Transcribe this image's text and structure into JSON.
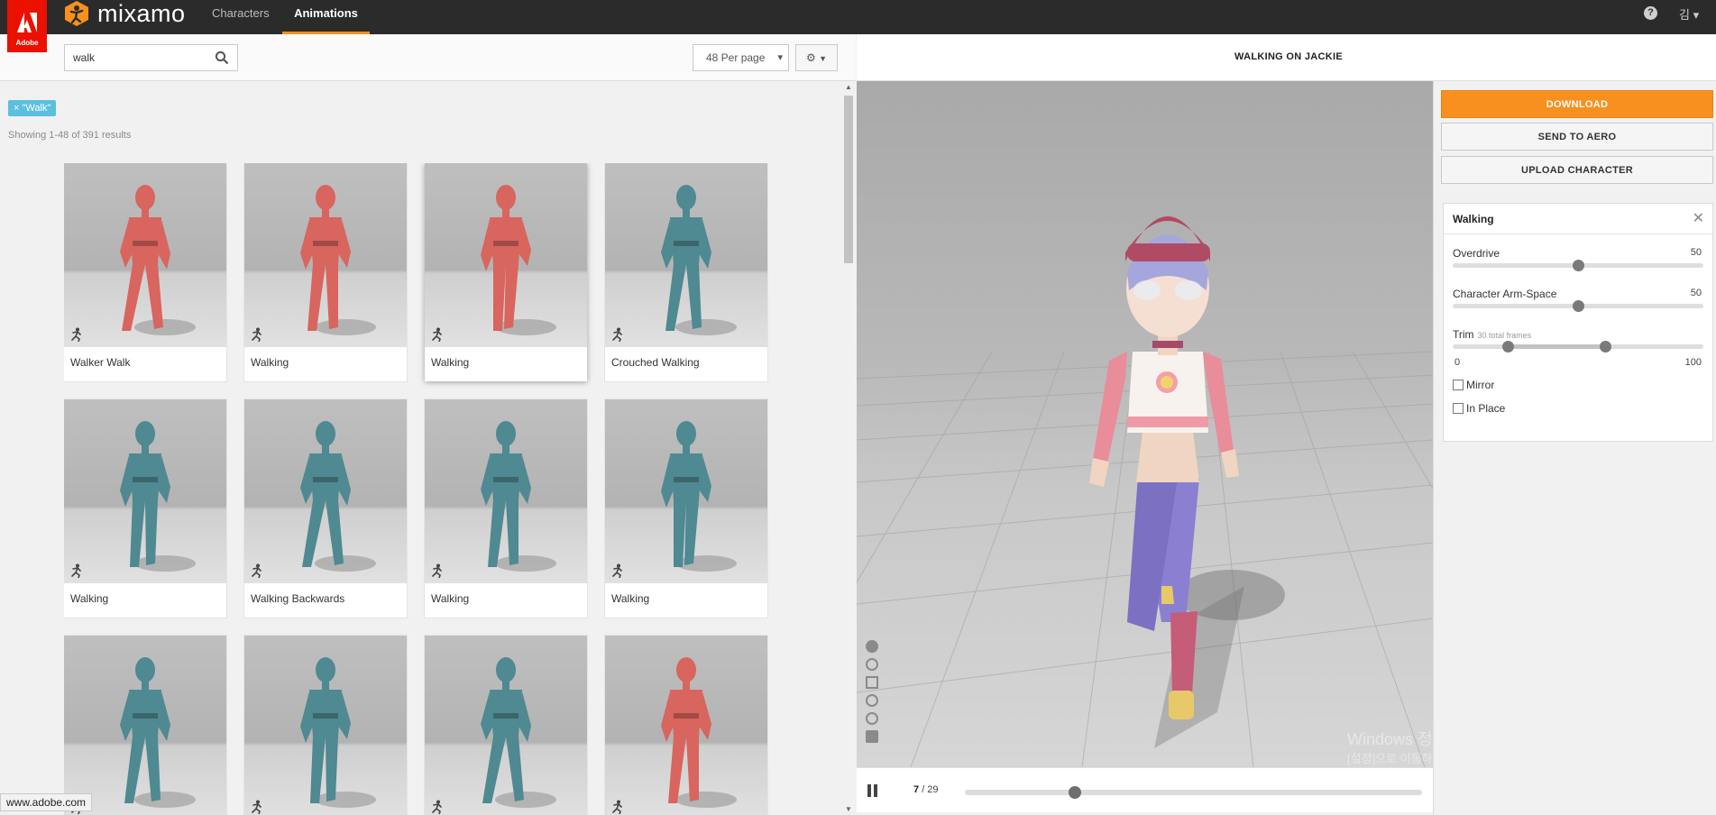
{
  "brand": {
    "adobe": "Adobe",
    "app": "mixamo"
  },
  "nav": {
    "tabs": [
      "Characters",
      "Animations"
    ],
    "active": "Animations",
    "help_icon": "question-circle-icon",
    "user": "김"
  },
  "search": {
    "value": "walk",
    "icon": "search-icon"
  },
  "toolbar": {
    "per_page": "48 Per page",
    "settings_icon": "gear-icon"
  },
  "filter": {
    "tag": "× \"Walk\""
  },
  "results": {
    "count": "Showing 1-48 of 391 results"
  },
  "cards": [
    {
      "label": "Walker Walk",
      "model": "red"
    },
    {
      "label": "Walking",
      "model": "red"
    },
    {
      "label": "Walking",
      "model": "red",
      "selected": true
    },
    {
      "label": "Crouched Walking",
      "model": "teal"
    },
    {
      "label": "Walking",
      "model": "teal"
    },
    {
      "label": "Walking Backwards",
      "model": "teal"
    },
    {
      "label": "Walking",
      "model": "teal"
    },
    {
      "label": "Walking",
      "model": "teal"
    },
    {
      "label": "",
      "model": "teal"
    },
    {
      "label": "",
      "model": "teal"
    },
    {
      "label": "",
      "model": "teal"
    },
    {
      "label": "",
      "model": "red"
    }
  ],
  "viewer": {
    "title": "WALKING ON JACKIE",
    "current_frame": "7",
    "total_frames": "/ 29",
    "playhead": 0.24,
    "tools": [
      "skull-icon",
      "rotate-icon",
      "move-icon",
      "zoom-icon",
      "power-icon",
      "camera-icon"
    ]
  },
  "actions": {
    "download": "DOWNLOAD",
    "send_to_aero": "SEND TO AERO",
    "upload_character": "UPLOAD CHARACTER"
  },
  "settings": {
    "title": "Walking",
    "overdrive": {
      "label": "Overdrive",
      "value": "50",
      "fraction": 0.5
    },
    "arm_space": {
      "label": "Character Arm-Space",
      "value": "50",
      "fraction": 0.5
    },
    "trim": {
      "label": "Trim",
      "note": "30 total frames",
      "min": "0",
      "max": "100",
      "start": 0.22,
      "end": 0.61
    },
    "mirror": {
      "label": "Mirror",
      "checked": false
    },
    "in_place": {
      "label": "In Place",
      "checked": false
    }
  },
  "overlay": {
    "watermark_title": "Windows 정품 인증",
    "watermark_text": "[설정]으로 이동하여 Windows를 정품 인증합니다.",
    "status_url": "www.adobe.com"
  },
  "colors": {
    "accent": "#f7901e",
    "adobe_red": "#eb1000",
    "tag": "#5bc0de",
    "red_model": "#d8655e",
    "teal_model": "#4f8991"
  }
}
